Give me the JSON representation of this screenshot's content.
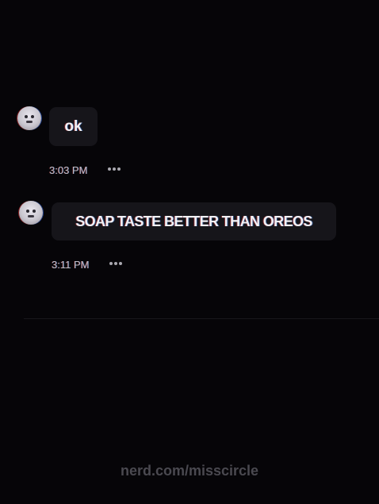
{
  "conversation": {
    "messages": [
      {
        "text": "ok",
        "time": "3:03 PM"
      },
      {
        "text": "SOAP TASTE BETTER THAN OREOS",
        "time": "3:11 PM"
      }
    ]
  },
  "watermark": {
    "text": "nerd.com/misscircle"
  },
  "icons": {
    "avatar": "user-avatar-icon",
    "more": "more-options-icon"
  },
  "colors": {
    "background": "#060508",
    "bubble": "#16151a",
    "text": "#f2f1f5",
    "timestamp": "#bdbcc3",
    "watermark": "#4a4950"
  }
}
